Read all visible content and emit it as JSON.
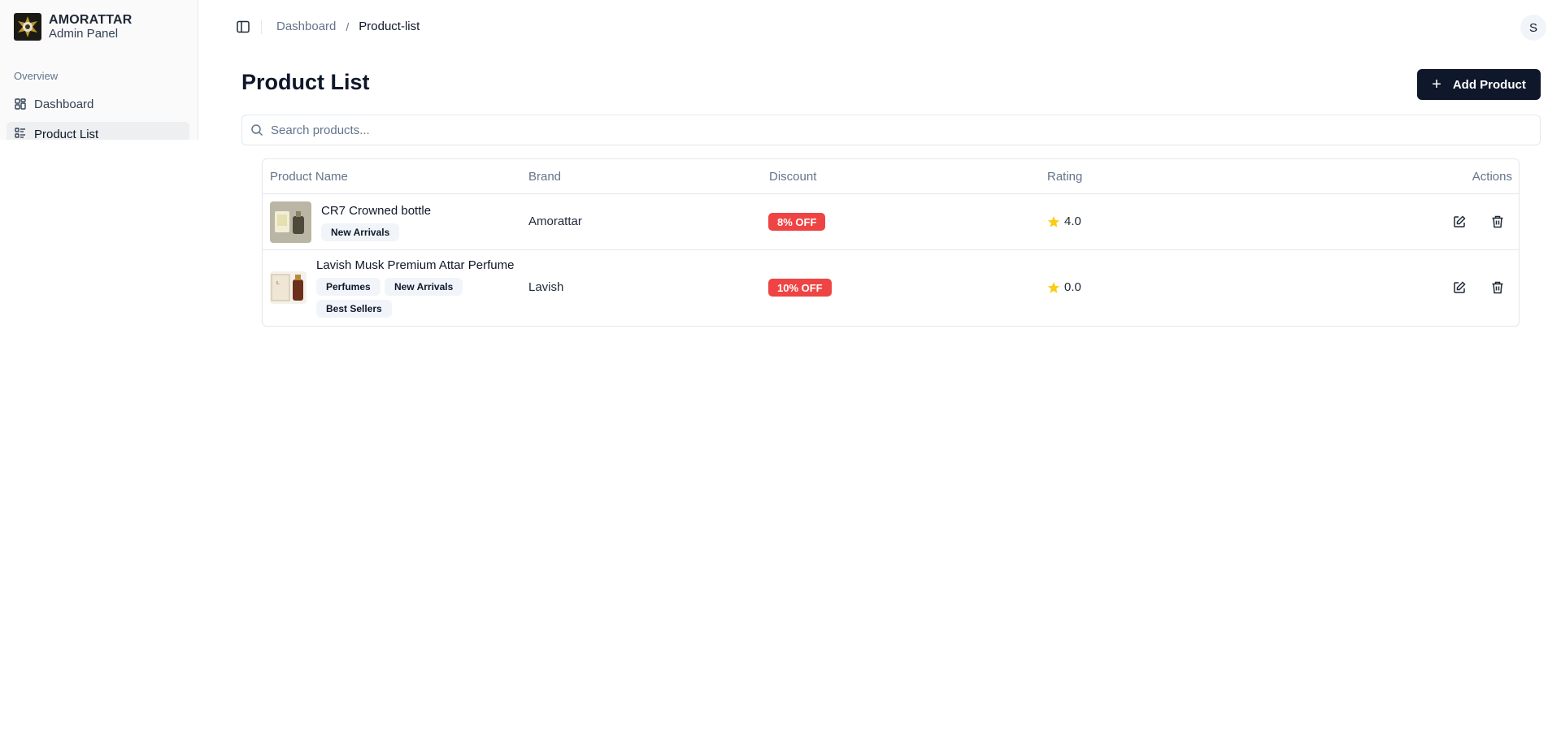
{
  "sidebar": {
    "brand_name": "AMORATTAR",
    "brand_sub": "Admin Panel",
    "group_label": "Overview",
    "items": [
      {
        "label": "Dashboard",
        "icon": "grid-icon"
      },
      {
        "label": "Product List",
        "icon": "list-icon"
      }
    ]
  },
  "header": {
    "breadcrumb": [
      "Dashboard",
      "Product-list"
    ],
    "avatar_initial": "S"
  },
  "main": {
    "title": "Product List",
    "add_button": "Add Product",
    "search_placeholder": "Search products..."
  },
  "table": {
    "columns": [
      "Product Name",
      "Brand",
      "Discount",
      "Rating",
      "Actions"
    ],
    "rows": [
      {
        "name": "CR7 Crowned bottle",
        "tags": [
          "New Arrivals"
        ],
        "brand": "Amorattar",
        "discount": "8% OFF",
        "rating": "4.0"
      },
      {
        "name": "Lavish Musk Premium Attar Perfume",
        "tags": [
          "Perfumes",
          "New Arrivals",
          "Best Sellers"
        ],
        "brand": "Lavish",
        "discount": "10% OFF",
        "rating": "0.0"
      }
    ]
  },
  "colors": {
    "primary": "#0f172a",
    "discount": "#ef4444",
    "star": "#facc15"
  }
}
